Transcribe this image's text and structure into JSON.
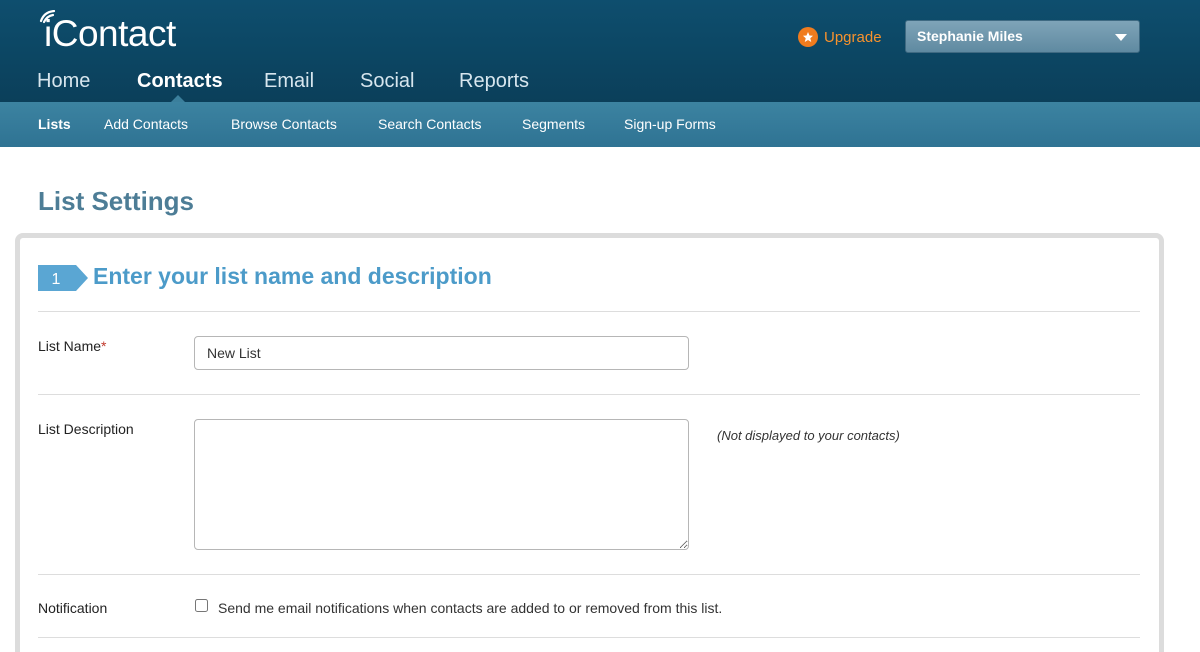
{
  "header": {
    "logo_text": "iContact",
    "upgrade_label": "Upgrade",
    "user_name": "Stephanie Miles"
  },
  "main_nav": {
    "items": [
      {
        "label": "Home"
      },
      {
        "label": "Contacts",
        "active": true
      },
      {
        "label": "Email"
      },
      {
        "label": "Social"
      },
      {
        "label": "Reports"
      }
    ]
  },
  "sub_nav": {
    "items": [
      {
        "label": "Lists",
        "active": true
      },
      {
        "label": "Add Contacts"
      },
      {
        "label": "Browse Contacts"
      },
      {
        "label": "Search Contacts"
      },
      {
        "label": "Segments"
      },
      {
        "label": "Sign-up Forms"
      }
    ]
  },
  "page": {
    "title": "List Settings",
    "step": {
      "number": "1",
      "title": "Enter your list name and description"
    },
    "list_name": {
      "label": "List Name",
      "required_marker": "*",
      "value": "New List"
    },
    "list_description": {
      "label": "List Description",
      "value": "",
      "hint": "(Not displayed to your contacts)"
    },
    "notification": {
      "label": "Notification",
      "checkbox_label": "Send me email notifications when contacts are added to or removed from this list.",
      "checked": false
    }
  },
  "colors": {
    "header_bg": "#0c4663",
    "subnav_bg": "#3379 98",
    "accent_blue": "#4c9bc9",
    "upgrade_orange": "#f07c1e",
    "title_blue": "#4d7d96"
  },
  "icons": {
    "logo_mark": "signal-waves-icon",
    "upgrade": "star-icon",
    "user_menu": "caret-down-icon",
    "step_badge": "arrow-badge-icon"
  }
}
